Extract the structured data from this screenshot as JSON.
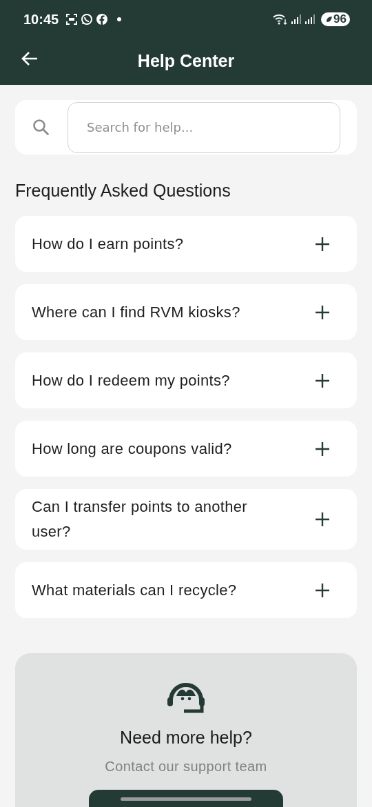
{
  "status_bar": {
    "time": "10:45",
    "battery": "96"
  },
  "app_bar": {
    "title": "Help Center"
  },
  "search": {
    "placeholder": "Search for help..."
  },
  "faq": {
    "heading": "Frequently Asked Questions",
    "items": [
      {
        "question": "How do I earn points?",
        "expanded": false
      },
      {
        "question": "Where can I find RVM kiosks?",
        "expanded": false
      },
      {
        "question": "How do I redeem my points?",
        "expanded": false
      },
      {
        "question": "How long are coupons valid?",
        "expanded": false
      },
      {
        "question": "Can I transfer points to another user?",
        "expanded": false
      },
      {
        "question": "What materials can I recycle?",
        "expanded": false
      }
    ]
  },
  "support": {
    "title": "Need more help?",
    "subtitle": "Contact our support team"
  }
}
